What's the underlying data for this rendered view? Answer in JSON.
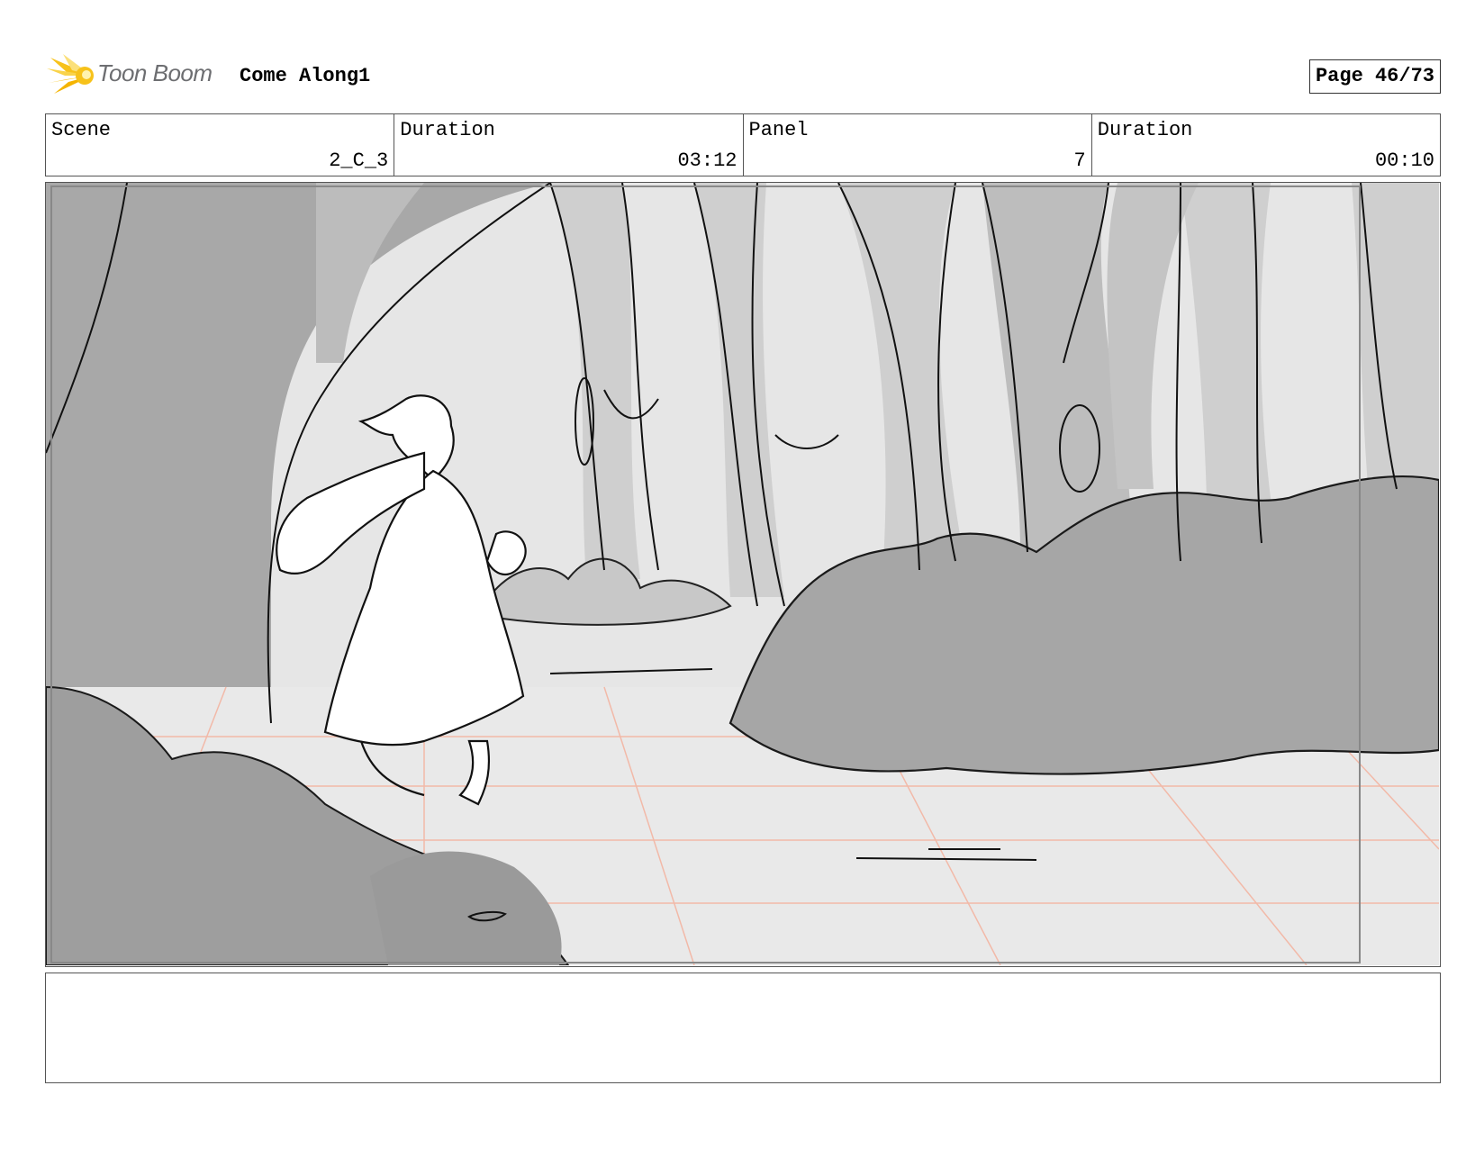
{
  "header": {
    "logo_text": "Toon Boom",
    "project_title": "Come Along1",
    "page_label": "Page 46/73"
  },
  "info": {
    "scene_label": "Scene",
    "scene_value": "2_C_3",
    "duration_label": "Duration",
    "duration_value": "03:12",
    "panel_label": "Panel",
    "panel_value": "7",
    "panel_duration_label": "Duration",
    "panel_duration_value": "00:10"
  },
  "notes": {
    "text": ""
  },
  "colors": {
    "logo_yellow": "#f7c21a",
    "grid_lines": "#f2b9a8",
    "bg_grey": "#e4e4e4",
    "mid_grey": "#bdbdbd",
    "dark_grey": "#a3a3a3"
  }
}
